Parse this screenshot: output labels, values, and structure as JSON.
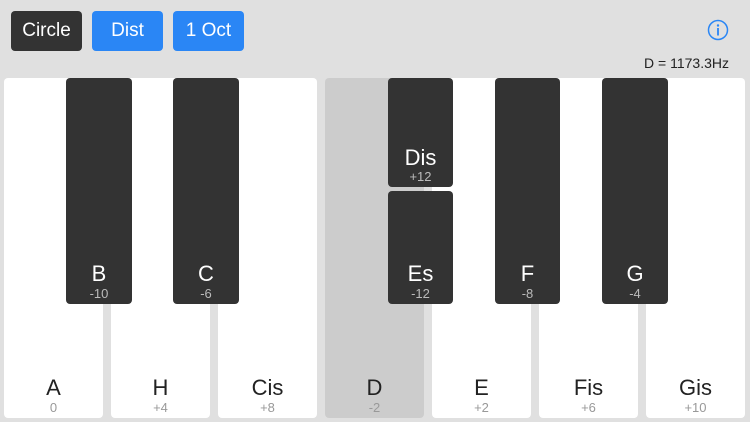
{
  "toolbar": {
    "circle_label": "Circle",
    "dist_label": "Dist",
    "octave_label": "1 Oct"
  },
  "info_icon": "info-circle-icon",
  "colors": {
    "accent": "#2a86f5",
    "dark_button": "#333333",
    "white_key": "#ffffff",
    "selected_key": "#cccccc",
    "black_key": "#333333",
    "background": "#e0e0e0"
  },
  "frequency_readout": "D = 1173.3Hz",
  "white_keys": [
    {
      "name": "A",
      "cents": "0"
    },
    {
      "name": "H",
      "cents": "+4"
    },
    {
      "name": "Cis",
      "cents": "+8"
    },
    {
      "name": "D",
      "cents": "-2"
    },
    {
      "name": "E",
      "cents": "+2"
    },
    {
      "name": "Fis",
      "cents": "+6"
    },
    {
      "name": "Gis",
      "cents": "+10"
    }
  ],
  "black_keys": [
    {
      "name": "B",
      "cents": "-10"
    },
    {
      "name": "C",
      "cents": "-6"
    },
    {
      "name": "Dis",
      "cents": "+12"
    },
    {
      "name": "Es",
      "cents": "-12"
    },
    {
      "name": "F",
      "cents": "-8"
    },
    {
      "name": "G",
      "cents": "-4"
    }
  ],
  "selected_key": "D"
}
